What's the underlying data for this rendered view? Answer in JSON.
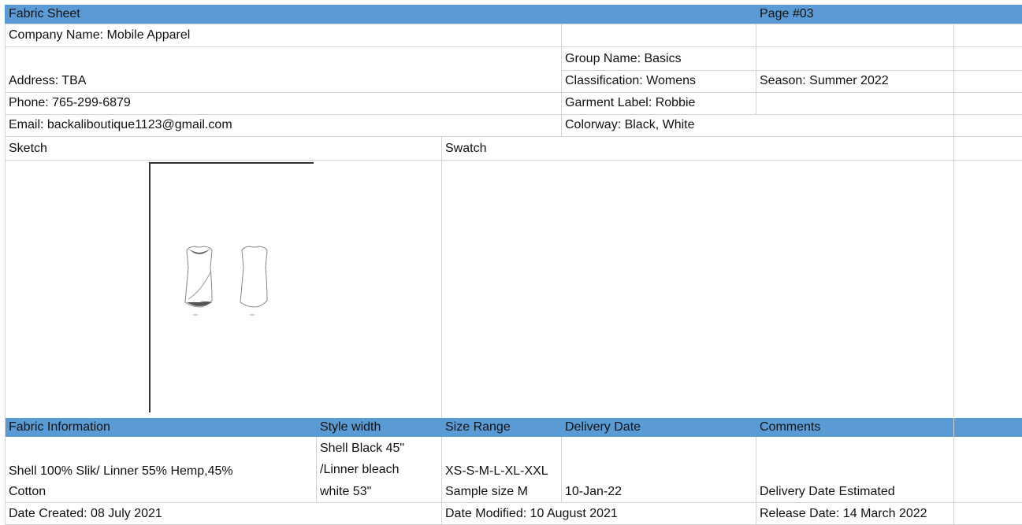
{
  "header": {
    "title": "Fabric Sheet",
    "page": "Page #03"
  },
  "company": {
    "name": "Company Name: Mobile Apparel",
    "address": "Address: TBA",
    "phone": "Phone: 765-299-6879",
    "email": "Email:  backaliboutique1123@gmail.com"
  },
  "details": {
    "group": "Group Name: Basics",
    "classification": "Classification: Womens",
    "season": "Season: Summer 2022",
    "garment_label": "Garment Label: Robbie",
    "colorway": "Colorway: Black, White"
  },
  "sections": {
    "sketch": "Sketch",
    "swatch": "Swatch"
  },
  "table_headers": {
    "fabric_info": "Fabric Information",
    "style_width": "Style width",
    "size_range": "Size Range",
    "delivery_date": "Delivery Date",
    "comments": "Comments"
  },
  "table_row": {
    "fabric_line1": "Shell 100% Slik/ Linner 55% Hemp,45%",
    "fabric_line2": "Cotton",
    "width_line1": "Shell Black 45\"",
    "width_line2": "/Linner bleach",
    "width_line3": "white 53\"",
    "size_line1": "XS-S-M-L-XL-XXL",
    "size_line2": "Sample size M",
    "delivery": "10-Jan-22",
    "comment": "Delivery Date Estimated"
  },
  "footer": {
    "created": "Date Created: 08 July 2021",
    "modified": "Date Modified: 10 August 2021",
    "release": "Release Date: 14 March 2022"
  },
  "colors": {
    "header_band": "#5b9bd5",
    "grid": "#d4d4d4"
  }
}
